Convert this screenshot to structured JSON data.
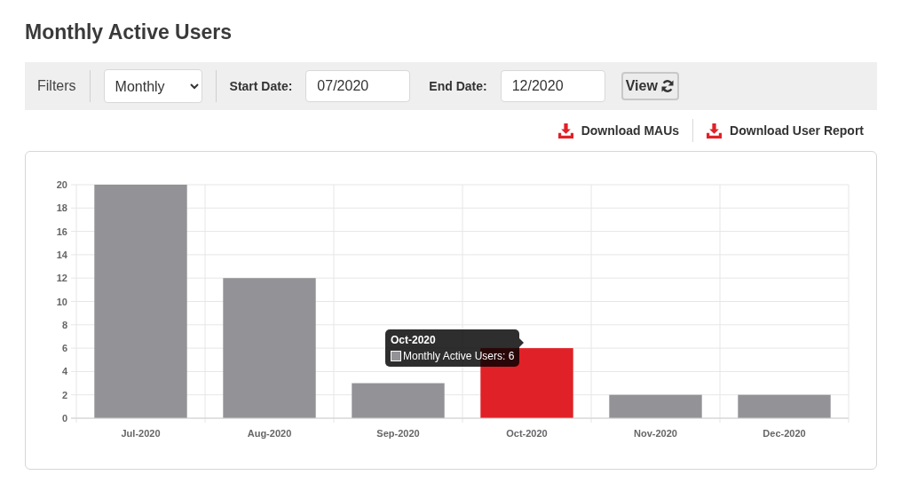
{
  "page_title": "Monthly Active Users",
  "filters": {
    "label": "Filters",
    "period": "Monthly",
    "start_label": "Start Date:",
    "start_value": "07/2020",
    "end_label": "End Date:",
    "end_value": "12/2020",
    "view_button": "View"
  },
  "downloads": [
    {
      "label": "Download MAUs"
    },
    {
      "label": "Download User Report"
    }
  ],
  "chart": {
    "chart_data": {
      "type": "bar",
      "categories": [
        "Jul-2020",
        "Aug-2020",
        "Sep-2020",
        "Oct-2020",
        "Nov-2020",
        "Dec-2020"
      ],
      "values": [
        20,
        12,
        3,
        6,
        2,
        2
      ],
      "ylim": [
        0,
        20
      ],
      "yticks": [
        0,
        2,
        4,
        6,
        8,
        10,
        12,
        14,
        16,
        18,
        20
      ],
      "grid": true
    },
    "bars": [
      {
        "color": "#939397"
      },
      {
        "color": "#939397"
      },
      {
        "color": "#939397"
      },
      {
        "color": "#e02127"
      },
      {
        "color": "#939397"
      },
      {
        "color": "#939397"
      }
    ],
    "tooltip": {
      "title": "Oct-2020",
      "label": "Monthly Active Users: 6"
    }
  }
}
